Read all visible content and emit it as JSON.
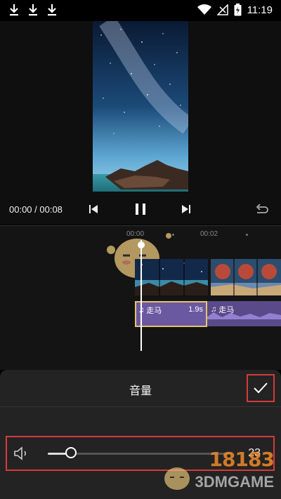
{
  "status_bar": {
    "time": "11:19"
  },
  "player": {
    "time_display": "00:00 / 00:08"
  },
  "timeline": {
    "ticks": [
      "00:00",
      "00:02"
    ],
    "audio": {
      "name": "走马",
      "duration": "1.9s",
      "name2": "走马"
    }
  },
  "panel": {
    "title": "音量"
  },
  "volume": {
    "value": "23",
    "level": 0.23
  },
  "watermark": {
    "logo": "18183",
    "sub": "3DMGAME"
  },
  "colors": {
    "highlight_border": "#d63a3a",
    "audio_selection": "#e6c46a",
    "audio_track": "#5a4a8a"
  }
}
